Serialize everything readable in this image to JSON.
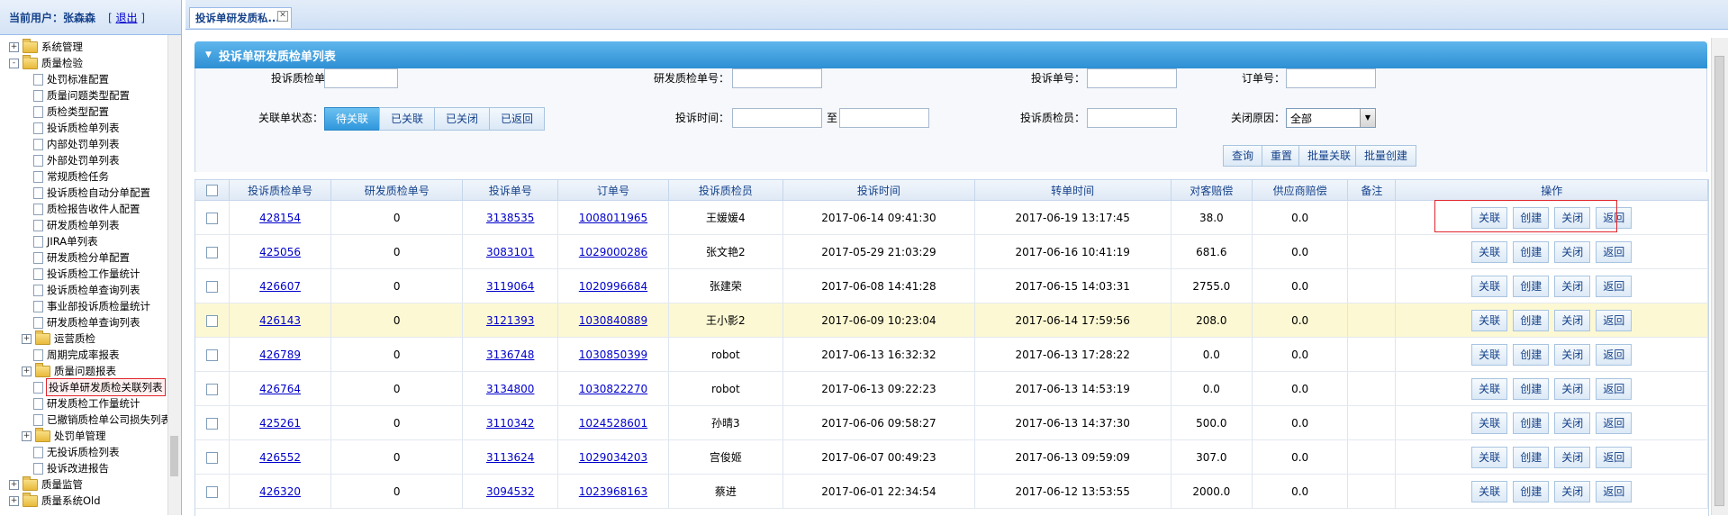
{
  "user": {
    "label": "当前用户：张森森",
    "logout": "退出"
  },
  "tree": [
    {
      "label": "系统管理",
      "type": "folder",
      "exp": "+",
      "lvl": 0
    },
    {
      "label": "质量检验",
      "type": "folder",
      "exp": "-",
      "lvl": 0
    },
    {
      "label": "处罚标准配置",
      "type": "doc",
      "lvl": 1
    },
    {
      "label": "质量问题类型配置",
      "type": "doc",
      "lvl": 1
    },
    {
      "label": "质检类型配置",
      "type": "doc",
      "lvl": 1
    },
    {
      "label": "投诉质检单列表",
      "type": "doc",
      "lvl": 1
    },
    {
      "label": "内部处罚单列表",
      "type": "doc",
      "lvl": 1
    },
    {
      "label": "外部处罚单列表",
      "type": "doc",
      "lvl": 1
    },
    {
      "label": "常规质检任务",
      "type": "doc",
      "lvl": 1
    },
    {
      "label": "投诉质检自动分单配置",
      "type": "doc",
      "lvl": 1
    },
    {
      "label": "质检报告收件人配置",
      "type": "doc",
      "lvl": 1
    },
    {
      "label": "研发质检单列表",
      "type": "doc",
      "lvl": 1
    },
    {
      "label": "JIRA单列表",
      "type": "doc",
      "lvl": 1
    },
    {
      "label": "研发质检分单配置",
      "type": "doc",
      "lvl": 1
    },
    {
      "label": "投诉质检工作量统计",
      "type": "doc",
      "lvl": 1
    },
    {
      "label": "投诉质检单查询列表",
      "type": "doc",
      "lvl": 1
    },
    {
      "label": "事业部投诉质检量统计",
      "type": "doc",
      "lvl": 1
    },
    {
      "label": "研发质检单查询列表",
      "type": "doc",
      "lvl": 1
    },
    {
      "label": "运营质检",
      "type": "folder",
      "exp": "+",
      "lvl": 1
    },
    {
      "label": "周期完成率报表",
      "type": "doc",
      "lvl": 1
    },
    {
      "label": "质量问题报表",
      "type": "folder",
      "exp": "+",
      "lvl": 1
    },
    {
      "label": "投诉单研发质检关联列表",
      "type": "doc",
      "lvl": 1,
      "sel": true
    },
    {
      "label": "研发质检工作量统计",
      "type": "doc",
      "lvl": 1
    },
    {
      "label": "已撤销质检单公司损失列表",
      "type": "doc",
      "lvl": 1
    },
    {
      "label": "处罚单管理",
      "type": "folder",
      "exp": "+",
      "lvl": 1
    },
    {
      "label": "无投诉质检列表",
      "type": "doc",
      "lvl": 1
    },
    {
      "label": "投诉改进报告",
      "type": "doc",
      "lvl": 1
    },
    {
      "label": "质量监管",
      "type": "folder",
      "exp": "+",
      "lvl": 0
    },
    {
      "label": "质量系统Old",
      "type": "folder",
      "exp": "+",
      "lvl": 0
    }
  ],
  "tab": {
    "label": "投诉单研发质私..."
  },
  "panel": {
    "title": "投诉单研发质检单列表"
  },
  "filters": {
    "complaint_qc_no": "投诉质检单号：",
    "rd_qc_no": "研发质检单号：",
    "complaint_no": "投诉单号：",
    "order_no": "订单号：",
    "link_status": "关联单状态：",
    "complaint_time": "投诉时间：",
    "to": "至",
    "complaint_inspector": "投诉质检员：",
    "close_reason": "关闭原因：",
    "close_reason_value": "全部",
    "status_tabs": [
      "待关联",
      "已关联",
      "已关闭",
      "已返回"
    ]
  },
  "actions": {
    "query": "查询",
    "reset": "重置",
    "batch_link": "批量关联",
    "batch_create": "批量创建"
  },
  "columns": [
    "投诉质检单号",
    "研发质检单号",
    "投诉单号",
    "订单号",
    "投诉质检员",
    "投诉时间",
    "转单时间",
    "对客赔偿",
    "供应商赔偿",
    "备注",
    "操作"
  ],
  "row_buttons": [
    "关联",
    "创建",
    "关闭",
    "返回"
  ],
  "rows": [
    {
      "cqc": "428154",
      "rdqc": "0",
      "cno": "3138535",
      "ono": "1008011965",
      "insp": "王媛媛4",
      "ctime": "2017-06-14 09:41:30",
      "ttime": "2017-06-19 13:17:45",
      "cust": "38.0",
      "supp": "0.0",
      "note": ""
    },
    {
      "cqc": "425056",
      "rdqc": "0",
      "cno": "3083101",
      "ono": "1029000286",
      "insp": "张文艳2",
      "ctime": "2017-05-29 21:03:29",
      "ttime": "2017-06-16 10:41:19",
      "cust": "681.6",
      "supp": "0.0",
      "note": ""
    },
    {
      "cqc": "426607",
      "rdqc": "0",
      "cno": "3119064",
      "ono": "1020996684",
      "insp": "张建荣",
      "ctime": "2017-06-08 14:41:28",
      "ttime": "2017-06-15 14:03:31",
      "cust": "2755.0",
      "supp": "0.0",
      "note": ""
    },
    {
      "cqc": "426143",
      "rdqc": "0",
      "cno": "3121393",
      "ono": "1030840889",
      "insp": "王小影2",
      "ctime": "2017-06-09 10:23:04",
      "ttime": "2017-06-14 17:59:56",
      "cust": "208.0",
      "supp": "0.0",
      "note": "",
      "hl": true
    },
    {
      "cqc": "426789",
      "rdqc": "0",
      "cno": "3136748",
      "ono": "1030850399",
      "insp": "robot",
      "ctime": "2017-06-13 16:32:32",
      "ttime": "2017-06-13 17:28:22",
      "cust": "0.0",
      "supp": "0.0",
      "note": ""
    },
    {
      "cqc": "426764",
      "rdqc": "0",
      "cno": "3134800",
      "ono": "1030822270",
      "insp": "robot",
      "ctime": "2017-06-13 09:22:23",
      "ttime": "2017-06-13 14:53:19",
      "cust": "0.0",
      "supp": "0.0",
      "note": ""
    },
    {
      "cqc": "425261",
      "rdqc": "0",
      "cno": "3110342",
      "ono": "1024528601",
      "insp": "孙晴3",
      "ctime": "2017-06-06 09:58:27",
      "ttime": "2017-06-13 14:37:30",
      "cust": "500.0",
      "supp": "0.0",
      "note": ""
    },
    {
      "cqc": "426552",
      "rdqc": "0",
      "cno": "3113624",
      "ono": "1029034203",
      "insp": "宫俊姬",
      "ctime": "2017-06-07 00:49:23",
      "ttime": "2017-06-13 09:59:09",
      "cust": "307.0",
      "supp": "0.0",
      "note": ""
    },
    {
      "cqc": "426320",
      "rdqc": "0",
      "cno": "3094532",
      "ono": "1023968163",
      "insp": "蔡进",
      "ctime": "2017-06-01 22:34:54",
      "ttime": "2017-06-12 13:53:55",
      "cust": "2000.0",
      "supp": "0.0",
      "note": ""
    }
  ]
}
